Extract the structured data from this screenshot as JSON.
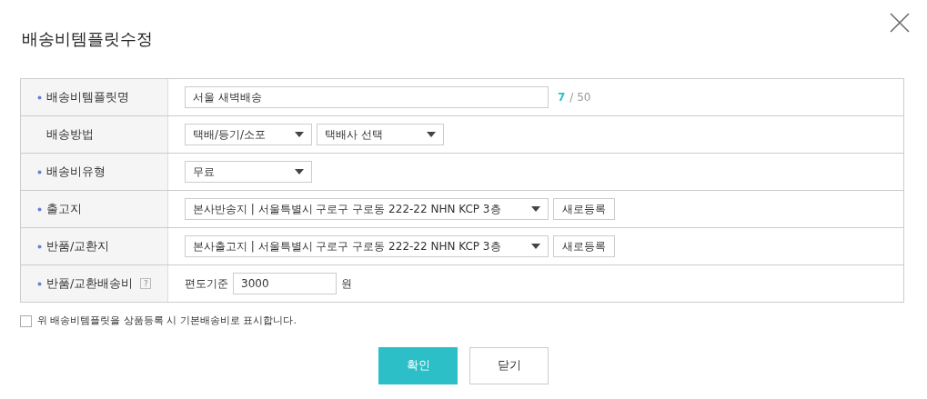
{
  "dialog": {
    "title": "배송비템플릿수정"
  },
  "rows": [
    {
      "label": "배송비템플릿명",
      "required": true,
      "kind": "text",
      "value": "서울 새벽배송",
      "count": "7",
      "max": "/ 50"
    },
    {
      "label": "배송방법",
      "required": false,
      "kind": "selects",
      "selects": [
        "택배/등기/소포",
        "택배사 선택"
      ]
    },
    {
      "label": "배송비유형",
      "required": true,
      "kind": "selects",
      "selects": [
        "무료"
      ]
    },
    {
      "label": "출고지",
      "required": true,
      "kind": "address",
      "select": "본사반송지 | 서울특별시 구로구 구로동 222-22 NHN KCP 3층",
      "button": "새로등록"
    },
    {
      "label": "반품/교환지",
      "required": true,
      "kind": "address",
      "select": "본사출고지 | 서울특별시 구로구 구로동 222-22 NHN KCP 3층",
      "button": "새로등록"
    },
    {
      "label": "반품/교환배송비",
      "required": true,
      "help": "?",
      "kind": "fee",
      "prefix": "편도기준",
      "value": "3000",
      "suffix": "원"
    }
  ],
  "checkbox": {
    "label": "위 배송비템플릿을 상품등록 시 기본배송비로 표시합니다.",
    "checked": false
  },
  "buttons": [
    {
      "label": "확인",
      "kind": "primary"
    },
    {
      "label": "닫기",
      "kind": "secondary"
    }
  ]
}
